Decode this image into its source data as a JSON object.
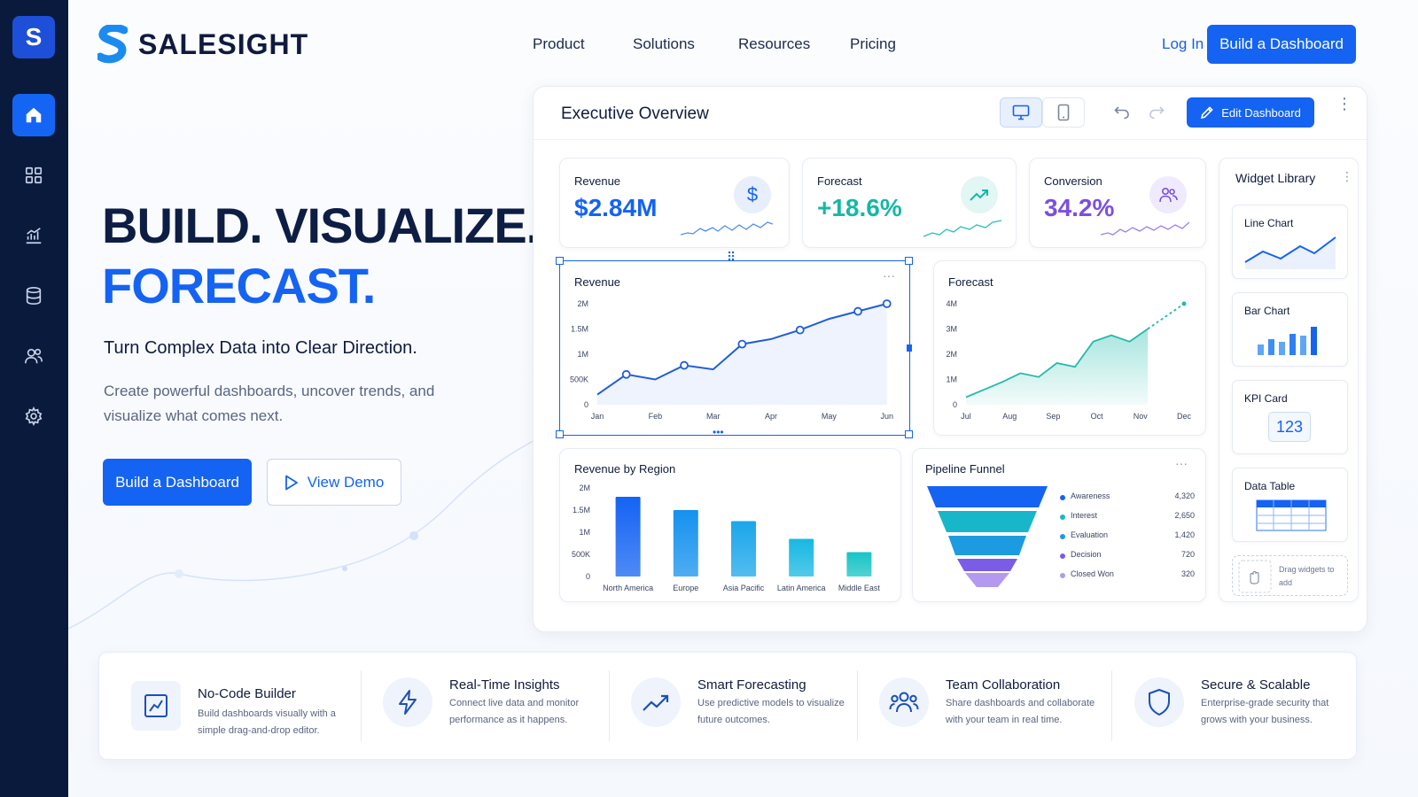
{
  "brand": {
    "name": "SALESIGHT",
    "logo_letter": "S"
  },
  "sidebar": {
    "items": [
      {
        "icon": "home-icon",
        "active": true
      },
      {
        "icon": "grid-icon",
        "active": false
      },
      {
        "icon": "chart-icon",
        "active": false
      },
      {
        "icon": "database-icon",
        "active": false
      },
      {
        "icon": "users-icon",
        "active": false
      },
      {
        "icon": "gear-icon",
        "active": false
      }
    ]
  },
  "nav": {
    "items": [
      "Product",
      "Solutions",
      "Resources",
      "Pricing"
    ],
    "login": "Log In",
    "cta": "Build a Dashboard"
  },
  "hero": {
    "line1": "BUILD. VISUALIZE.",
    "line2": "FORECAST.",
    "subtitle": "Turn Complex Data into Clear Direction.",
    "description": "Create powerful dashboards, uncover trends, and visualize what comes next.",
    "cta_primary": "Build a Dashboard",
    "cta_secondary": "View Demo"
  },
  "dashboard": {
    "title": "Executive Overview",
    "edit_label": "Edit Dashboard",
    "kpis": [
      {
        "label": "Revenue",
        "value": "$2.84M",
        "color": "#1463f3"
      },
      {
        "label": "Forecast",
        "value": "+18.6%",
        "color": "#15b8a6"
      },
      {
        "label": "Conversion",
        "value": "34.2%",
        "color": "#7b4fe0"
      }
    ],
    "revenue_chart": {
      "title": "Revenue"
    },
    "forecast_chart": {
      "title": "Forecast"
    },
    "region_chart": {
      "title": "Revenue by Region"
    },
    "funnel": {
      "title": "Pipeline Funnel",
      "stages": [
        {
          "name": "Awareness",
          "value": "4,320",
          "color": "#1463f3"
        },
        {
          "name": "Interest",
          "value": "2,650",
          "color": "#17b7c9"
        },
        {
          "name": "Evaluation",
          "value": "1,420",
          "color": "#1d9be0"
        },
        {
          "name": "Decision",
          "value": "720",
          "color": "#7a5ce6"
        },
        {
          "name": "Closed Won",
          "value": "320",
          "color": "#b39af0"
        }
      ]
    },
    "widget_library": {
      "title": "Widget Library",
      "items": [
        "Line Chart",
        "Bar Chart",
        "KPI Card",
        "Data Table"
      ],
      "kpi_sample": "123",
      "drag_hint": "Drag widgets to add"
    }
  },
  "chart_data": [
    {
      "type": "line",
      "title": "Revenue",
      "categories": [
        "Jan",
        "Feb",
        "Mar",
        "Apr",
        "May",
        "Jun"
      ],
      "x": [
        0,
        0.5,
        1,
        1.5,
        2,
        2.5,
        3,
        3.5,
        4,
        4.5,
        5
      ],
      "values": [
        200000,
        600000,
        500000,
        780000,
        700000,
        1200000,
        1300000,
        1480000,
        1700000,
        1850000,
        2000000
      ],
      "yticks": [
        "0",
        "500K",
        "1M",
        "1.5M",
        "2M"
      ],
      "ylim": [
        0,
        2000000
      ]
    },
    {
      "type": "area",
      "title": "Forecast",
      "categories": [
        "Jul",
        "Aug",
        "Sep",
        "Oct",
        "Nov",
        "Dec"
      ],
      "values": [
        300000,
        600000,
        900000,
        1250000,
        1100000,
        1650000,
        1500000,
        2500000,
        2750000,
        2500000,
        3000000
      ],
      "forecast_values": [
        3000000,
        3500000,
        4000000
      ],
      "yticks": [
        "0",
        "1M",
        "2M",
        "3M",
        "4M"
      ],
      "ylim": [
        0,
        4000000
      ]
    },
    {
      "type": "bar",
      "title": "Revenue by Region",
      "categories": [
        "North America",
        "Europe",
        "Asia Pacific",
        "Latin America",
        "Middle East"
      ],
      "values": [
        1800000,
        1500000,
        1250000,
        850000,
        550000
      ],
      "yticks": [
        "0",
        "500K",
        "1M",
        "1.5M",
        "2M"
      ],
      "ylim": [
        0,
        2000000
      ]
    }
  ],
  "features": [
    {
      "title": "No-Code Builder",
      "desc": "Build dashboards visually with a simple drag-and-drop editor.",
      "icon": "chart-line-icon"
    },
    {
      "title": "Real-Time Insights",
      "desc": "Connect live data and monitor performance as it happens.",
      "icon": "lightning-icon"
    },
    {
      "title": "Smart Forecasting",
      "desc": "Use predictive models to visualize future outcomes.",
      "icon": "trend-icon"
    },
    {
      "title": "Team Collaboration",
      "desc": "Share dashboards and collaborate with your team in real time.",
      "icon": "team-icon"
    },
    {
      "title": "Secure & Scalable",
      "desc": "Enterprise-grade security that grows with your business.",
      "icon": "shield-icon"
    }
  ]
}
